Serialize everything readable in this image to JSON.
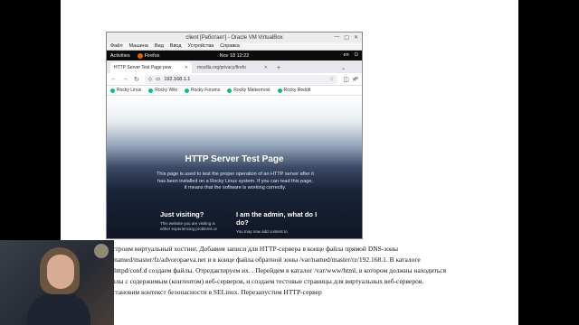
{
  "vm_window": {
    "title": "client [Работает] - Oracle VM VirtualBox",
    "menu": [
      "Файл",
      "Машина",
      "Вид",
      "Ввод",
      "Устройства",
      "Справка"
    ],
    "controls": [
      "—",
      "▢",
      "✕"
    ]
  },
  "gnome": {
    "activities": "Activities",
    "app": "Firefox",
    "clock": "Nov 18  12:22",
    "lang": "en",
    "tray": "⏻"
  },
  "browser": {
    "tabs": [
      {
        "label": "HTTP Server Test Page pow",
        "active": true
      },
      {
        "label": "mozilla.org/privacy/firefo",
        "active": false
      }
    ],
    "new_tab": "+",
    "url": "192.168.1.1",
    "bookmarks": [
      "Rocky Linux",
      "Rocky Wiki",
      "Rocky Forums",
      "Rocky Mattermost",
      "Rocky Reddit"
    ]
  },
  "page": {
    "title_normal": "HTTP Server ",
    "title_bold": "Test Page",
    "lead": "This page is used to test the proper operation of an HTTP server after it has been installed on a Rocky Linux system. If you can read this page, it means that the software is working correctly.",
    "visiting_heading": "Just visiting?",
    "visiting_text": "This website you are visiting is either experiencing problems or",
    "admin_heading": "I am the admin, what do I do?",
    "admin_text": "You may now add content to"
  },
  "doc": {
    "lines": [
      "строим виртуальный хостинг. Добавим записи для HTTP-сервера в конце файла прямой DNS-зоны",
      "/named/master/fz/advoropaeva.net и в конце файла обратной зоны /var/named/master/rz/192.168.1. В каталоге",
      "/httpd/conf.d создаем файлы. Отредактируем их. . Перейдем в каталог /var/www/html, в котором должны находиться",
      "ллы с содержимым (контентом) веб-серверов, и создаем тестовые страницы для виртуальных веб-серверов.",
      "становим контекст безопасности в SELinux. Перезапустим HTTP-сервер"
    ]
  }
}
